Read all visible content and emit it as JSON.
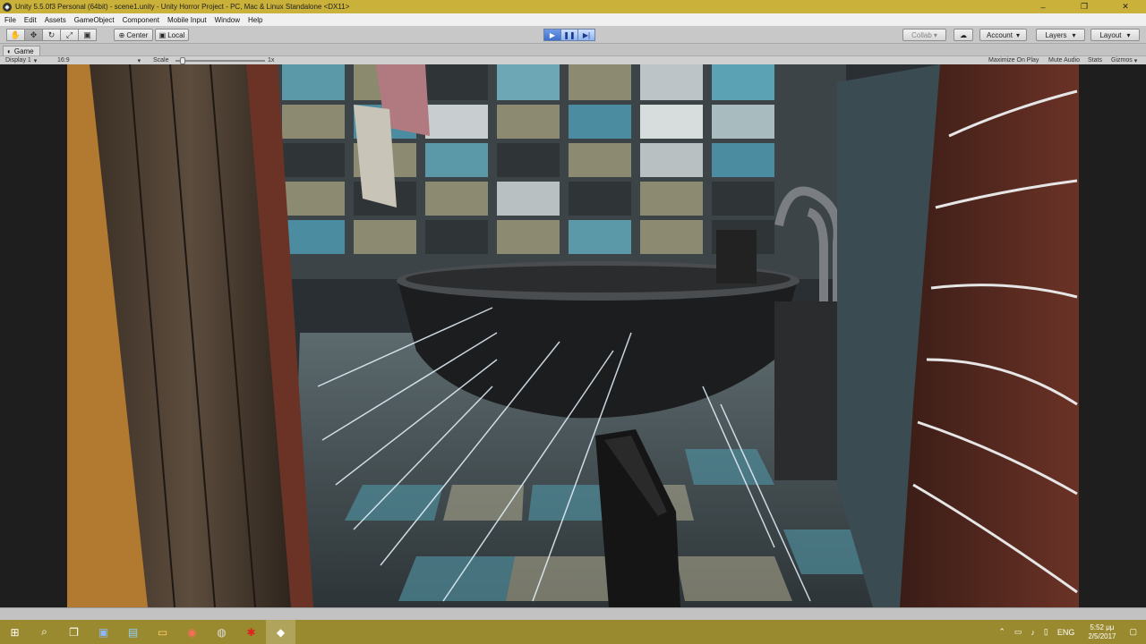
{
  "window": {
    "title": "Unity 5.5.0f3 Personal (64bit) - scene1.unity - Unity Horror Project - PC, Mac & Linux Standalone <DX11>",
    "app_icon": "unity-icon",
    "controls": {
      "minimize": "–",
      "maximize": "❐",
      "close": "✕"
    }
  },
  "menu": {
    "items": [
      "File",
      "Edit",
      "Assets",
      "GameObject",
      "Component",
      "Mobile Input",
      "Window",
      "Help"
    ]
  },
  "toolbar": {
    "tools": [
      "hand-tool-icon",
      "move-tool-icon",
      "rotate-tool-icon",
      "scale-tool-icon",
      "rect-tool-icon"
    ],
    "pivot_label": "Center",
    "space_label": "Local",
    "play_icons": {
      "play": "▶",
      "pause": "❚❚",
      "step": "▶|"
    },
    "collab_label": "Collab",
    "cloud_icon": "☁",
    "account_label": "Account",
    "layers_label": "Layers",
    "layout_label": "Layout"
  },
  "game_view": {
    "tab_label": "Game",
    "display_label": "Display 1",
    "aspect_label": "16:9",
    "scale_label": "Scale",
    "scale_value": "1x",
    "scale_level": 0.05,
    "maximize_label": "Maximize On Play",
    "mute_label": "Mute Audio",
    "stats_label": "Stats",
    "gizmos_label": "Gizmos"
  },
  "taskbar": {
    "apps": [
      "start-icon",
      "search-icon",
      "task-view-icon",
      "visual-studio-icon",
      "store-icon",
      "explorer-icon",
      "chrome-icon",
      "app-icon",
      "red-app-icon",
      "unity-taskbar-icon"
    ],
    "language": "ENG",
    "time": "5:52 μμ",
    "date": "2/5/2017"
  },
  "colors": {
    "titlebar": "#c9b13a",
    "taskbar": "#9a8a2f",
    "accent": "#3e70cc"
  }
}
